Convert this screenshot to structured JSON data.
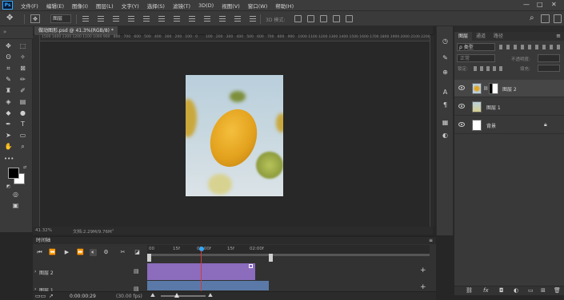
{
  "menu": [
    "文件(F)",
    "编辑(E)",
    "图像(I)",
    "图层(L)",
    "文字(Y)",
    "选择(S)",
    "滤镜(T)",
    "3D(D)",
    "视图(V)",
    "窗口(W)",
    "帮助(H)"
  ],
  "app_logo": "Ps",
  "window_controls": [
    "—",
    "□",
    "✕"
  ],
  "options": {
    "layer_select": "图层",
    "mode_3d": "3D 模式:"
  },
  "document": {
    "tab_label": "做动图形.psd @ 41.3%(RGB/8) *",
    "status_zoom": "41.32%",
    "status_doc": "文档:2.29M/9.76M"
  },
  "rulers": {
    "h_ticks": [
      "1500",
      "1400",
      "1300",
      "1200",
      "1100",
      "1000",
      "900",
      "800",
      "700",
      "600",
      "500",
      "400",
      "300",
      "200",
      "100",
      "0",
      "100",
      "200",
      "300",
      "400",
      "500",
      "600",
      "700",
      "800",
      "900",
      "1000",
      "1100",
      "1200",
      "1300",
      "1400",
      "1500",
      "1600",
      "1700",
      "1800",
      "1900",
      "2000",
      "2100",
      "2200"
    ]
  },
  "layers_panel": {
    "tabs": [
      "图层",
      "通道",
      "路径"
    ],
    "filter_label": "ρ 类型",
    "blend_mode": "正常",
    "opacity_label": "不透明度:",
    "lock_label": "锁定:",
    "fill_label": "填充:",
    "layers": [
      {
        "name": "图层 2",
        "selected": true
      },
      {
        "name": "图层 1",
        "selected": false
      },
      {
        "name": "背景",
        "selected": false,
        "locked": true
      }
    ]
  },
  "timeline": {
    "title": "时间轴",
    "ticks": [
      "00",
      "15f",
      "01:00f",
      "15f",
      "02:00f"
    ],
    "tracks": [
      "图层 2",
      "图层 1"
    ],
    "timecode": "0:00:00:29",
    "fps": "(30.00 fps)"
  },
  "colors": {
    "clip_purple": "#8b6cbd",
    "clip_blue": "#5a79a8",
    "playhead": "#d23a3a",
    "accent": "#31a8ff"
  }
}
